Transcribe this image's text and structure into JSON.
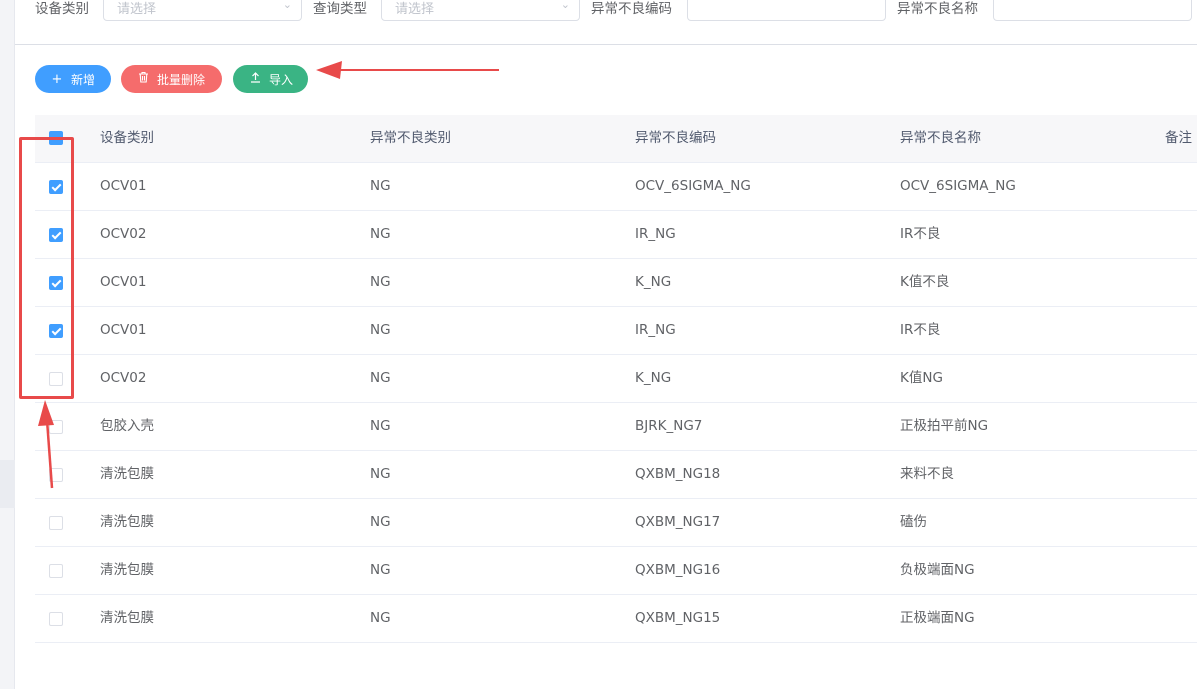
{
  "filters": [
    {
      "label": "设备类别",
      "placeholder": "请选择"
    },
    {
      "label": "查询类型",
      "placeholder": "请选择"
    },
    {
      "label": "异常不良编码",
      "value": ""
    },
    {
      "label": "异常不良名称",
      "value": ""
    }
  ],
  "toolbar": {
    "add_label": "新增",
    "batch_delete_label": "批量删除",
    "import_label": "导入"
  },
  "table": {
    "headers": [
      "设备类别",
      "异常不良类别",
      "异常不良编码",
      "异常不良名称",
      "备注"
    ],
    "rows": [
      {
        "checked": true,
        "cells": [
          "OCV01",
          "NG",
          "OCV_6SIGMA_NG",
          "OCV_6SIGMA_NG",
          ""
        ]
      },
      {
        "checked": true,
        "cells": [
          "OCV02",
          "NG",
          "IR_NG",
          "IR不良",
          ""
        ]
      },
      {
        "checked": true,
        "cells": [
          "OCV01",
          "NG",
          "K_NG",
          "K值不良",
          ""
        ]
      },
      {
        "checked": true,
        "cells": [
          "OCV01",
          "NG",
          "IR_NG",
          "IR不良",
          ""
        ]
      },
      {
        "checked": false,
        "cells": [
          "OCV02",
          "NG",
          "K_NG",
          "K值NG",
          ""
        ]
      },
      {
        "checked": false,
        "cells": [
          "包胶入壳",
          "NG",
          "BJRK_NG7",
          "正极拍平前NG",
          ""
        ]
      },
      {
        "checked": false,
        "cells": [
          "清洗包膜",
          "NG",
          "QXBM_NG18",
          "来料不良",
          ""
        ]
      },
      {
        "checked": false,
        "cells": [
          "清洗包膜",
          "NG",
          "QXBM_NG17",
          "磕伤",
          ""
        ]
      },
      {
        "checked": false,
        "cells": [
          "清洗包膜",
          "NG",
          "QXBM_NG16",
          "负极端面NG",
          ""
        ]
      },
      {
        "checked": false,
        "cells": [
          "清洗包膜",
          "NG",
          "QXBM_NG15",
          "正极端面NG",
          ""
        ]
      }
    ]
  },
  "colors": {
    "primary": "#409eff",
    "danger": "#f56c6c",
    "success": "#3ab484",
    "annotation": "#e84a4a"
  }
}
